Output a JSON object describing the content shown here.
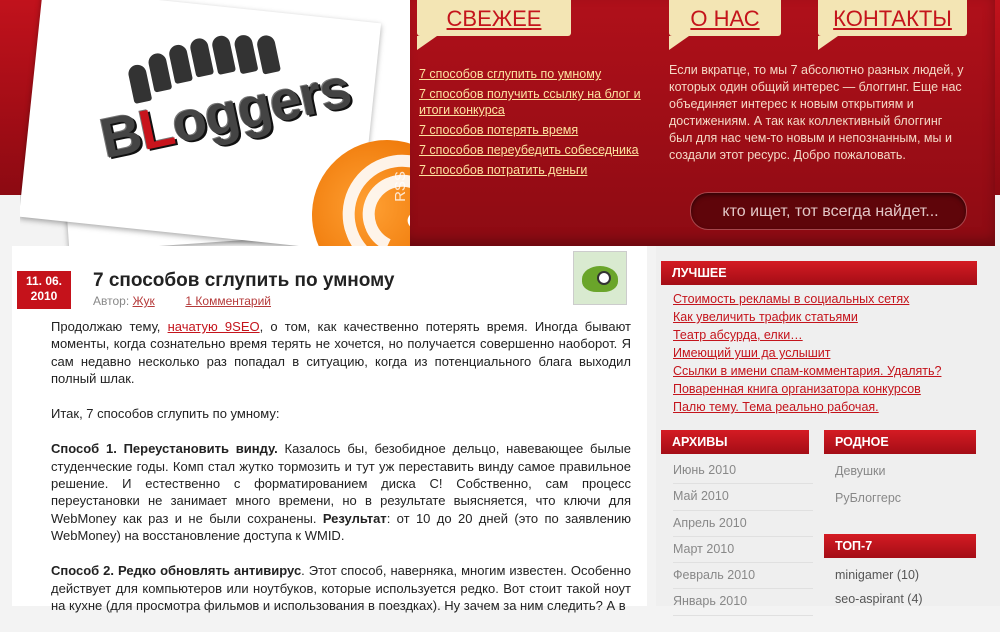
{
  "site": {
    "logo_text": "Bloggers",
    "rss_label": "RSS"
  },
  "nav": {
    "fresh": "СВЕЖЕЕ",
    "about": "О НАС",
    "contacts": "КОНТАКТЫ"
  },
  "fresh_links": [
    "7 способов сглупить по умному",
    "7 способов получить ссылку на блог и итоги конкурса",
    "7 способов потерять время",
    "7 способов переубедить собеседника",
    "7 способов потратить деньги"
  ],
  "about_text": "Если вкратце, то мы 7 абсолютно разных людей, у которых один общий интерес — блоггинг. Еще нас объединяет интерес к новым открытиям и достижениям. А так как коллективный блоггинг был для нас чем-то новым и непознанным, мы и создали этот ресурс. Добро пожаловать.",
  "search": {
    "placeholder": "кто ищет, тот всегда найдет..."
  },
  "post": {
    "date_line1": "11. 06.",
    "date_line2": "2010",
    "title": "7 способов сглупить по умному",
    "author_label": "Автор:",
    "author": "Жук",
    "comments": "1 Комментарий",
    "p1_a": "Продолжаю тему, ",
    "p1_link": "начатую 9SEO",
    "p1_b": ", о том, как качественно потерять время. Иногда бывают моменты, когда сознательно время терять не хочется, но получается совершенно наоборот. Я сам недавно несколько раз попадал в ситуацию, когда из потенциального блага выходил полный шлак.",
    "p2": "Итак, 7 способов сглупить по умному:",
    "p3_strong": "Способ 1. Переустановить винду.",
    "p3_a": " Казалось бы, безобидное дельцо, навевающее былые студенческие годы. Комп стал жутко тормозить и тут уж переставить винду самое правильное решение. И естественно с форматированием диска С! Собственно, сам процесс переустановки не занимает много времени, но в результате выясняется, что ключи для WebMoney как раз и не были сохранены. ",
    "p3_result": "Результат",
    "p3_b": ": от 10 до 20 дней (это по заявлению WebMoney) на восстановление доступа к WMID.",
    "p4_strong": "Способ 2. Редко обновлять антивирус",
    "p4_a": ". Этот способ, наверняка, многим известен. Особенно действует для компьютеров или ноутбуков, которые используется редко. Вот стоит такой ноут на кухне (для просмотра фильмов и использования в поездках). Ну зачем за ним следить? А в"
  },
  "sidebar": {
    "best_title": "ЛУЧШЕЕ",
    "best": [
      "Стоимость рекламы в социальных сетях",
      "Как увеличить трафик статьями",
      "Театр абсурда, елки…",
      "Имеющий уши да услышит",
      "Ссылки в имени спам-комментария. Удалять?",
      "Поваренная книга организатора конкурсов",
      "Палю тему. Тема реально рабочая."
    ],
    "archives_title": "АРХИВЫ",
    "archives": [
      "Июнь 2010",
      "Май 2010",
      "Апрель 2010",
      "Март 2010",
      "Февраль 2010",
      "Январь 2010"
    ],
    "native_title": "РОДНОЕ",
    "native": [
      "Девушки",
      "РуБлоггерс"
    ],
    "top_title": "ТОП-7",
    "top": [
      {
        "name": "minigamer",
        "count": "(10)"
      },
      {
        "name": "seo-aspirant",
        "count": "(4)"
      }
    ]
  },
  "colors": {
    "brand_red": "#c4141c",
    "tab_bg": "#f3e5b4",
    "link_yellow": "#fde3a0"
  }
}
